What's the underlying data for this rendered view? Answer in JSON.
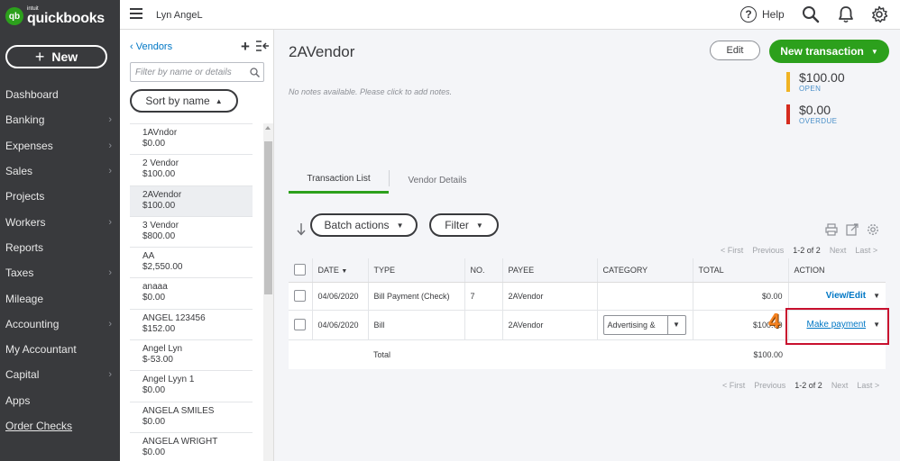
{
  "app": {
    "logo_small": "intuit",
    "logo_name": "quickbooks",
    "logo_badge": "qb"
  },
  "nav": {
    "new_label": "New",
    "items": [
      {
        "label": "Dashboard",
        "chevron": false
      },
      {
        "label": "Banking",
        "chevron": true
      },
      {
        "label": "Expenses",
        "chevron": true
      },
      {
        "label": "Sales",
        "chevron": true
      },
      {
        "label": "Projects",
        "chevron": false
      },
      {
        "label": "Workers",
        "chevron": true
      },
      {
        "label": "Reports",
        "chevron": false
      },
      {
        "label": "Taxes",
        "chevron": true
      },
      {
        "label": "Mileage",
        "chevron": false
      },
      {
        "label": "Accounting",
        "chevron": true
      },
      {
        "label": "My Accountant",
        "chevron": false
      },
      {
        "label": "Capital",
        "chevron": true
      },
      {
        "label": "Apps",
        "chevron": false
      },
      {
        "label": "Order Checks",
        "chevron": false,
        "link": true
      }
    ]
  },
  "topbar": {
    "company": "Lyn AngeL",
    "help": "Help"
  },
  "vendor_panel": {
    "back_label": "Vendors",
    "filter_placeholder": "Filter by name or details",
    "sort_label": "Sort by name",
    "vendors": [
      {
        "name": "1AVndor",
        "amount": "$0.00"
      },
      {
        "name": "2 Vendor",
        "amount": "$100.00"
      },
      {
        "name": "2AVendor",
        "amount": "$100.00",
        "selected": true
      },
      {
        "name": "3 Vendor",
        "amount": "$800.00"
      },
      {
        "name": "AA",
        "amount": "$2,550.00"
      },
      {
        "name": "anaaa",
        "amount": "$0.00"
      },
      {
        "name": "ANGEL 123456",
        "amount": "$152.00"
      },
      {
        "name": "Angel Lyn",
        "amount": "$-53.00"
      },
      {
        "name": "Angel Lyyn 1",
        "amount": "$0.00"
      },
      {
        "name": "ANGELA SMILES",
        "amount": "$0.00"
      },
      {
        "name": "ANGELA WRIGHT",
        "amount": "$0.00"
      }
    ]
  },
  "main": {
    "title": "2AVendor",
    "notes": "No notes available. Please click to add notes.",
    "edit_label": "Edit",
    "new_transaction_label": "New transaction",
    "open_amount": "$100.00",
    "open_label": "OPEN",
    "overdue_amount": "$0.00",
    "overdue_label": "OVERDUE",
    "colors": {
      "open": "#f0b323",
      "overdue": "#d52b1e",
      "brand": "#2ca01c"
    },
    "tabs": [
      "Transaction List",
      "Vendor Details"
    ],
    "batch_label": "Batch actions",
    "filter_label": "Filter",
    "pager": {
      "first": "< First",
      "previous": "Previous",
      "range": "1-2 of 2",
      "next": "Next",
      "last": "Last >"
    }
  },
  "table": {
    "headers": {
      "date": "DATE",
      "type": "TYPE",
      "no": "NO.",
      "payee": "PAYEE",
      "category": "CATEGORY",
      "total": "TOTAL",
      "action": "ACTION"
    },
    "rows": [
      {
        "date": "04/06/2020",
        "type": "Bill Payment (Check)",
        "no": "7",
        "payee": "2AVendor",
        "category": "",
        "total": "$0.00",
        "action": "View/Edit"
      },
      {
        "date": "04/06/2020",
        "type": "Bill",
        "no": "",
        "payee": "2AVendor",
        "category": "Advertising &",
        "total": "$100.00",
        "action": "Make payment"
      }
    ],
    "total_label": "Total",
    "total_value": "$100.00"
  },
  "annotation": {
    "step_number": "4"
  }
}
